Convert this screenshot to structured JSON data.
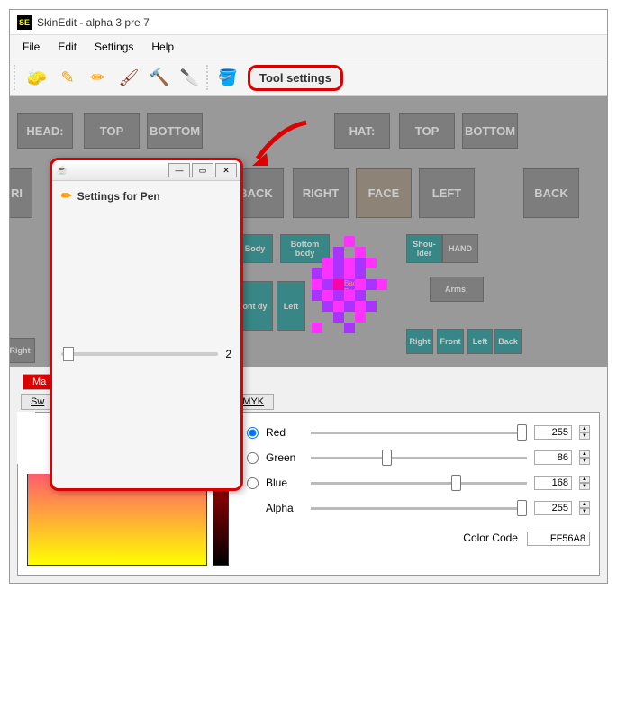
{
  "app": {
    "icon_text": "SE",
    "title": "SkinEdit - alpha 3 pre 7"
  },
  "menu": {
    "file": "File",
    "edit": "Edit",
    "settings": "Settings",
    "help": "Help"
  },
  "toolbar": {
    "tool_settings": "Tool settings"
  },
  "regions": {
    "head": "HEAD:",
    "top1": "TOP",
    "bottom1": "BOTTOM",
    "hat": "HAT:",
    "top2": "TOP",
    "bottom2": "BOTTOM",
    "ri": "RI",
    "back1": "BACK",
    "right1": "RIGHT",
    "face": "FACE",
    "left1": "LEFT",
    "back2": "BACK",
    "body": "Body",
    "botbody": "Bottom body",
    "shoulder": "Shou-lder",
    "hand": "HAND",
    "ontdy": "ont dy",
    "leftm": "Left",
    "backbody": "Back Body",
    "arms": "Arms:",
    "rightb": "Right",
    "rightb2": "Right",
    "front": "Front",
    "leftb": "Left",
    "backb": "Back"
  },
  "popup": {
    "title": "Settings for Pen",
    "slider_value": "2"
  },
  "tabs": {
    "ma": "Ma",
    "sw": "Sw",
    "myk": "MYK"
  },
  "color": {
    "red": "Red",
    "green": "Green",
    "blue": "Blue",
    "alpha": "Alpha",
    "red_v": "255",
    "green_v": "86",
    "blue_v": "168",
    "alpha_v": "255",
    "code_label": "Color Code",
    "code": "FF56A8"
  }
}
